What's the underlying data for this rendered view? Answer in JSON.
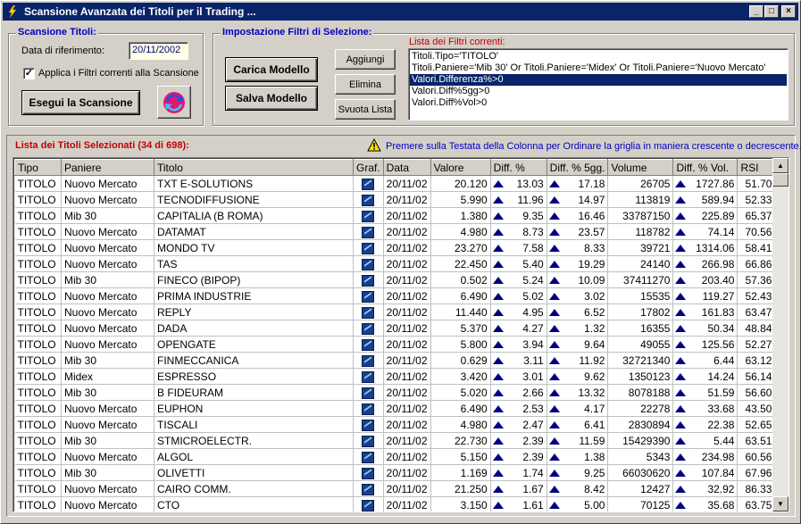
{
  "window": {
    "title": "Scansione Avanzata dei Titoli per il Trading ...",
    "min_label": "_",
    "max_label": "□",
    "close_label": "×"
  },
  "scan": {
    "legend": "Scansione Titoli:",
    "date_label": "Data di riferimento:",
    "date_value": "20/11/2002",
    "apply_label": "Applica i Filtri correnti alla Scansione",
    "apply_checked": "✓",
    "run_button": "Esegui la Scansione"
  },
  "filters": {
    "legend": "Impostazione Filtri di Selezione:",
    "load_button": "Carica Modello",
    "save_button": "Salva Modello",
    "add_button": "Aggiungi",
    "delete_button": "Elimina",
    "clear_button": "Svuota Lista",
    "current_label": "Lista dei Filtri correnti:",
    "items": [
      "Titoli.Tipo='TITOLO'",
      "Titoli.Paniere='Mib 30' Or Titoli.Paniere='Midex' Or Titoli.Paniere='Nuovo Mercato'",
      "Valori.Differenza%>0",
      "Valori.Diff%5gg>0",
      "Valori.Diff%Vol>0"
    ],
    "selected_index": 2
  },
  "results": {
    "title": "Lista dei Titoli Selezionati (34 di 698):",
    "hint": "Premere sulla Testata della Colonna per Ordinare la griglia in maniera crescente o decrescente.",
    "columns": [
      "Tipo",
      "Paniere",
      "Titolo",
      "Graf.",
      "Data",
      "Valore",
      "Diff. %",
      "Diff. % 5gg.",
      "Volume",
      "Diff. % Vol.",
      "RSI"
    ],
    "rows": [
      [
        "TITOLO",
        "Nuovo Mercato",
        "TXT E-SOLUTIONS",
        "20/11/02",
        "20.120",
        "13.03",
        "17.18",
        "26705",
        "1727.86",
        "51.70"
      ],
      [
        "TITOLO",
        "Nuovo Mercato",
        "TECNODIFFUSIONE",
        "20/11/02",
        "5.990",
        "11.96",
        "14.97",
        "113819",
        "589.94",
        "52.33"
      ],
      [
        "TITOLO",
        "Mib 30",
        "CAPITALIA (B ROMA)",
        "20/11/02",
        "1.380",
        "9.35",
        "16.46",
        "33787150",
        "225.89",
        "65.37"
      ],
      [
        "TITOLO",
        "Nuovo Mercato",
        "DATAMAT",
        "20/11/02",
        "4.980",
        "8.73",
        "23.57",
        "118782",
        "74.14",
        "70.56"
      ],
      [
        "TITOLO",
        "Nuovo Mercato",
        "MONDO TV",
        "20/11/02",
        "23.270",
        "7.58",
        "8.33",
        "39721",
        "1314.06",
        "58.41"
      ],
      [
        "TITOLO",
        "Nuovo Mercato",
        "TAS",
        "20/11/02",
        "22.450",
        "5.40",
        "19.29",
        "24140",
        "266.98",
        "66.86"
      ],
      [
        "TITOLO",
        "Mib 30",
        "FINECO (BIPOP)",
        "20/11/02",
        "0.502",
        "5.24",
        "10.09",
        "37411270",
        "203.40",
        "57.36"
      ],
      [
        "TITOLO",
        "Nuovo Mercato",
        "PRIMA INDUSTRIE",
        "20/11/02",
        "6.490",
        "5.02",
        "3.02",
        "15535",
        "119.27",
        "52.43"
      ],
      [
        "TITOLO",
        "Nuovo Mercato",
        "REPLY",
        "20/11/02",
        "11.440",
        "4.95",
        "6.52",
        "17802",
        "161.83",
        "63.47"
      ],
      [
        "TITOLO",
        "Nuovo Mercato",
        "DADA",
        "20/11/02",
        "5.370",
        "4.27",
        "1.32",
        "16355",
        "50.34",
        "48.84"
      ],
      [
        "TITOLO",
        "Nuovo Mercato",
        "OPENGATE",
        "20/11/02",
        "5.800",
        "3.94",
        "9.64",
        "49055",
        "125.56",
        "52.27"
      ],
      [
        "TITOLO",
        "Mib 30",
        "FINMECCANICA",
        "20/11/02",
        "0.629",
        "3.11",
        "11.92",
        "32721340",
        "6.44",
        "63.12"
      ],
      [
        "TITOLO",
        "Midex",
        "ESPRESSO",
        "20/11/02",
        "3.420",
        "3.01",
        "9.62",
        "1350123",
        "14.24",
        "56.14"
      ],
      [
        "TITOLO",
        "Mib 30",
        "B FIDEURAM",
        "20/11/02",
        "5.020",
        "2.66",
        "13.32",
        "8078188",
        "51.59",
        "56.60"
      ],
      [
        "TITOLO",
        "Nuovo Mercato",
        "EUPHON",
        "20/11/02",
        "6.490",
        "2.53",
        "4.17",
        "22278",
        "33.68",
        "43.50"
      ],
      [
        "TITOLO",
        "Nuovo Mercato",
        "TISCALI",
        "20/11/02",
        "4.980",
        "2.47",
        "6.41",
        "2830894",
        "22.38",
        "52.65"
      ],
      [
        "TITOLO",
        "Mib 30",
        "STMICROELECTR.",
        "20/11/02",
        "22.730",
        "2.39",
        "11.59",
        "15429390",
        "5.44",
        "63.51"
      ],
      [
        "TITOLO",
        "Nuovo Mercato",
        "ALGOL",
        "20/11/02",
        "5.150",
        "2.39",
        "1.38",
        "5343",
        "234.98",
        "60.56"
      ],
      [
        "TITOLO",
        "Mib 30",
        "OLIVETTI",
        "20/11/02",
        "1.169",
        "1.74",
        "9.25",
        "66030620",
        "107.84",
        "67.96"
      ],
      [
        "TITOLO",
        "Nuovo Mercato",
        "CAIRO COMM.",
        "20/11/02",
        "21.250",
        "1.67",
        "8.42",
        "12427",
        "32.92",
        "86.33"
      ],
      [
        "TITOLO",
        "Nuovo Mercato",
        "CTO",
        "20/11/02",
        "3.150",
        "1.61",
        "5.00",
        "70125",
        "35.68",
        "63.75"
      ]
    ]
  }
}
